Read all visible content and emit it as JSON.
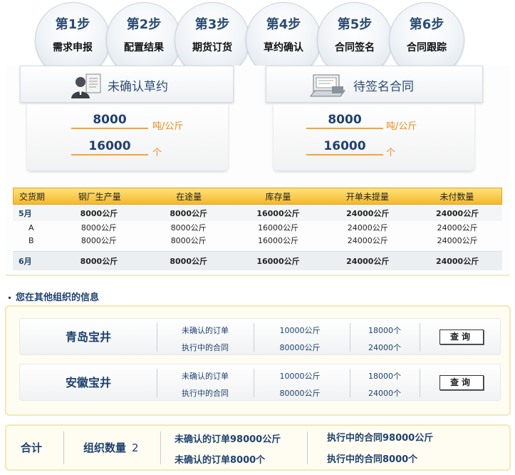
{
  "steps": [
    {
      "num": "第1步",
      "label": "需求申报"
    },
    {
      "num": "第2步",
      "label": "配置结果"
    },
    {
      "num": "第3步",
      "label": "期货订货"
    },
    {
      "num": "第4步",
      "label": "草约确认"
    },
    {
      "num": "第5步",
      "label": "合同签名"
    },
    {
      "num": "第6步",
      "label": "合同跟踪"
    }
  ],
  "unconfirmed_draft": {
    "title": "未确认草约",
    "weight_value": "8000",
    "weight_unit": "吨/公斤",
    "count_value": "16000",
    "count_unit": "个",
    "icon": "person-document-icon"
  },
  "pending_contract": {
    "title": "待签名合同",
    "weight_value": "8000",
    "weight_unit": "吨/公斤",
    "count_value": "16000",
    "count_unit": "个",
    "icon": "contract-document-icon"
  },
  "delivery_table": {
    "headers": [
      "交货期",
      "钢厂生产量",
      "在途量",
      "库存量",
      "开单未提量",
      "未付数量"
    ],
    "rows": [
      {
        "period": "5月",
        "production": "8000公斤",
        "in_transit": "8000公斤",
        "stock": "16000公斤",
        "unpicked": "24000公斤",
        "unpaid": "24000公斤",
        "type": "main"
      },
      {
        "period": "A",
        "production": "8000公斤",
        "in_transit": "8000公斤",
        "stock": "16000公斤",
        "unpicked": "24000公斤",
        "unpaid": "24000公斤",
        "type": "sub"
      },
      {
        "period": "B",
        "production": "8000公斤",
        "in_transit": "8000公斤",
        "stock": "16000公斤",
        "unpicked": "24000公斤",
        "unpaid": "24000公斤",
        "type": "sub"
      },
      {
        "period": "6月",
        "production": "8000公斤",
        "in_transit": "8000公斤",
        "stock": "16000公斤",
        "unpicked": "24000公斤",
        "unpaid": "24000公斤",
        "type": "main2"
      }
    ]
  },
  "other_orgs": {
    "section_title": "您在其他组织的信息",
    "orgs": [
      {
        "name": "青岛宝井",
        "line1_label": "未确认的订单",
        "line1_weight": "10000公斤",
        "line1_count": "18000个",
        "line2_label": "执行中的合同",
        "line2_weight": "80000公斤",
        "line2_count": "24000个",
        "button": "查询"
      },
      {
        "name": "安徽宝井",
        "line1_label": "未确认的订单",
        "line1_weight": "10000公斤",
        "line1_count": "18000个",
        "line2_label": "执行中的合同",
        "line2_weight": "80000公斤",
        "line2_count": "24000个",
        "button": "查询"
      }
    ]
  },
  "total": {
    "label": "合计",
    "org_count_label": "组织数量",
    "org_count": "2",
    "unconfirmed_weight": "未确认的订单98000公斤",
    "unconfirmed_count": "未确认的订单8000个",
    "executing_weight": "执行中的合同98000公斤",
    "executing_count": "执行中的合同8000个"
  },
  "colors": {
    "accent_blue": "#1e4170",
    "accent_orange": "#ec8b17",
    "header_yellow": "#f4b82c"
  }
}
